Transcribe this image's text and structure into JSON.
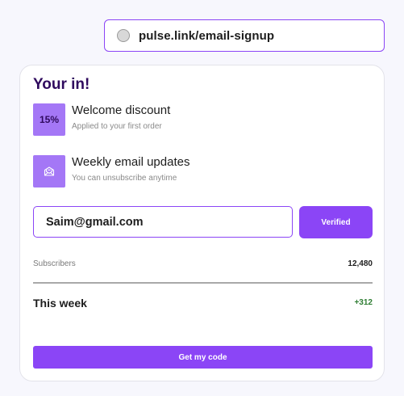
{
  "address_bar": {
    "url": "pulse.link/email-signup"
  },
  "card": {
    "title": "Your in!",
    "benefits": [
      {
        "badge": "15%",
        "title": "Welcome discount",
        "subtitle": "Applied to your first order"
      },
      {
        "icon": "mail-open-icon",
        "title": "Weekly email updates",
        "subtitle": "You can unsubscribe anytime"
      }
    ],
    "email": {
      "value": "Saim@gmail.com"
    },
    "verify_button_label": "Verified",
    "stats": {
      "subscribers_label": "Subscribers",
      "subscribers_value": "12,480",
      "week_label": "This week",
      "week_value": "+312"
    },
    "cta_label": "Get my code"
  },
  "colors": {
    "accent": "#8b45f6",
    "badge": "#a477f6",
    "title": "#2f0a5e",
    "positive": "#2e7d32"
  }
}
